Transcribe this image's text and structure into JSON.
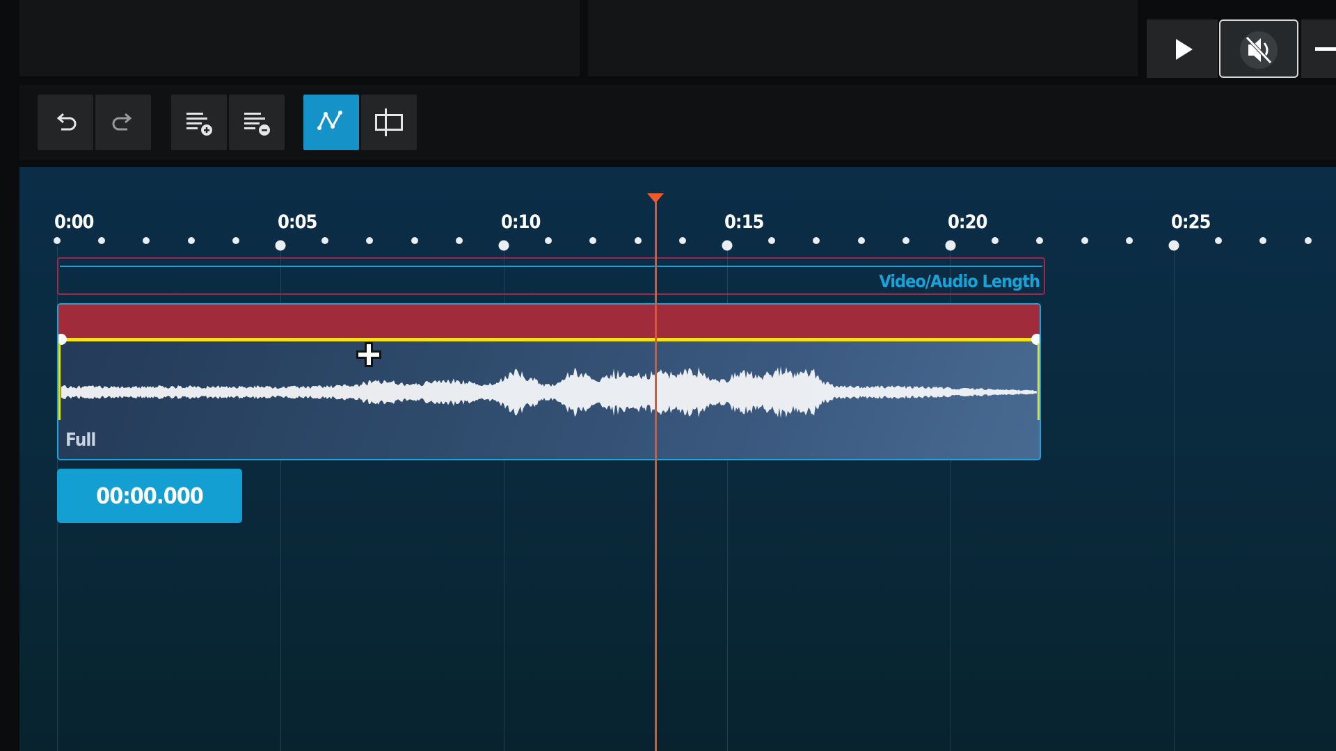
{
  "timeline": {
    "ruler_labels": [
      "0:00",
      "0:05",
      "0:10",
      "0:15",
      "0:20",
      "0:25"
    ],
    "length_bar_label": "Video/Audio Length",
    "clip_label": "Full",
    "current_time": "00:00.000",
    "playhead_seconds": 13.4
  },
  "icons": {
    "toolbar": [
      "undo-icon",
      "redo-icon",
      "add-track-icon",
      "remove-track-icon",
      "keyframe-curve-icon",
      "crop-trim-icon"
    ],
    "media": [
      "play-icon",
      "mute-icon",
      "minus-icon"
    ],
    "cursor": "move-cursor-icon"
  },
  "colors": {
    "accent": "#1593c9",
    "clip_header": "#a02c3b",
    "volume_line": "#f2e11b",
    "playhead": "#e0562b",
    "length_bar_border": "#a0284d"
  }
}
